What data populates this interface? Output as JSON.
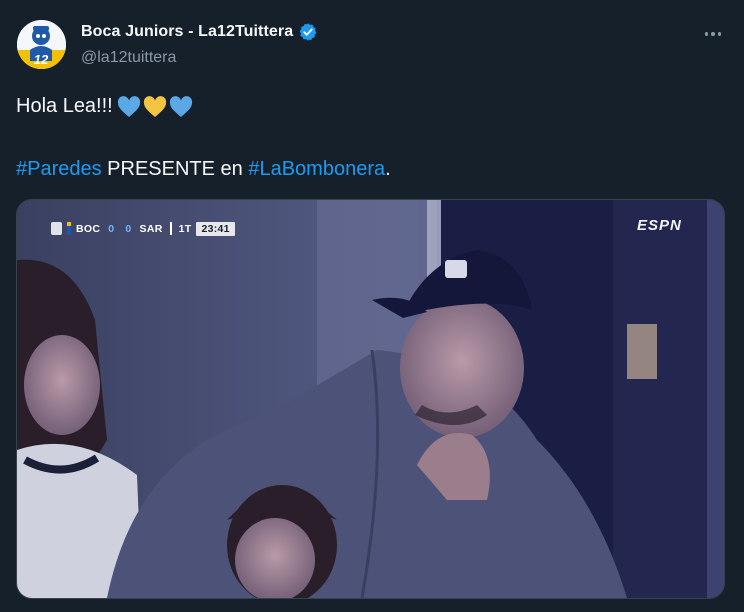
{
  "tweet": {
    "author_name": "Boca Juniors - La12Tuittera",
    "handle": "@la12tuittera",
    "text_line1": "Hola Lea!!!",
    "hearts": [
      "💙",
      "💛",
      "💙"
    ],
    "line2": {
      "tag1": "#Paredes",
      "middle": " PRESENTE en ",
      "tag2": "#LaBombonera",
      "end": "."
    }
  },
  "icons": {
    "verified": "verified-badge-icon",
    "more": "more-options-icon",
    "avatar": "la12-logo-avatar"
  },
  "colors": {
    "background": "#15202b",
    "link": "#1d9bf0",
    "muted": "#8b98a5",
    "verified": "#1d9bf0",
    "heart_blue": "#5aa9e6",
    "heart_yellow": "#f4c542"
  },
  "media": {
    "broadcaster": "ESPN",
    "scorebug": {
      "home": "BOC",
      "home_score": "0",
      "away_score": "0",
      "away": "SAR",
      "period": "1T",
      "clock": "23:41"
    }
  }
}
